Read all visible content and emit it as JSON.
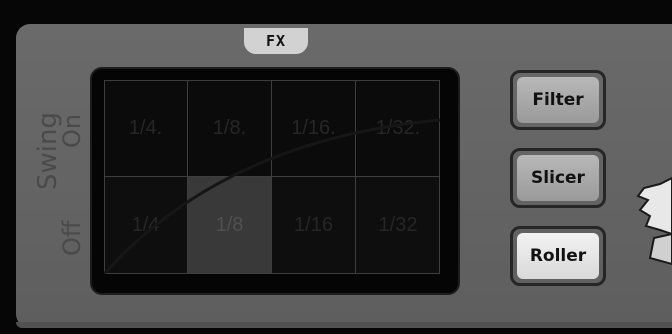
{
  "fx_panel": {
    "tab_label": "FX",
    "swing": {
      "label": "Swing",
      "on_label": "On",
      "off_label": "Off"
    },
    "grid": {
      "rows": [
        [
          "1/4.",
          "1/8.",
          "1/16.",
          "1/32."
        ],
        [
          "1/4",
          "1/8",
          "1/16",
          "1/32"
        ]
      ],
      "active_cell": "1/8"
    },
    "buttons": {
      "filter": "Filter",
      "slicer": "Slicer",
      "roller": "Roller"
    }
  }
}
